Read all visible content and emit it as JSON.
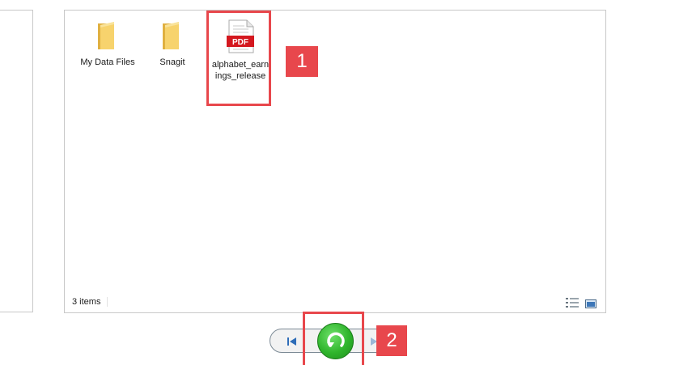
{
  "files": [
    {
      "name": "My Data Files",
      "type": "folder",
      "icon": "folder-icon"
    },
    {
      "name": "Snagit",
      "type": "folder",
      "icon": "folder-icon"
    },
    {
      "name": "alphabet_earnings_release",
      "type": "pdf",
      "icon": "pdf-icon",
      "badge": "PDF"
    }
  ],
  "status": {
    "item_count": "3 items"
  },
  "steps": [
    "1",
    "2"
  ],
  "colors": {
    "highlight": "#e8474c",
    "pdf_red": "#d4181f",
    "folder": "#f3c75a",
    "replay_green": "#2fb52c"
  }
}
